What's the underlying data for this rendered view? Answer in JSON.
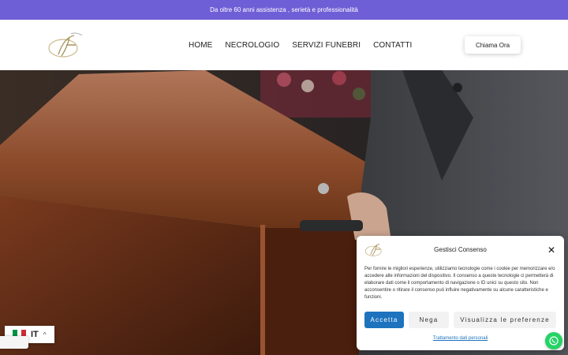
{
  "topbar": {
    "text": "Da oltre 60 anni assistenza , serietà e professionalità"
  },
  "header": {
    "nav": [
      "HOME",
      "NECROLOGIO",
      "SERVIZI FUNEBRI",
      "CONTATTI"
    ],
    "call_label": "Chiama Ora"
  },
  "language": {
    "code": "IT"
  },
  "consent": {
    "title": "Gestisci Consenso",
    "text": "Per fornire le migliori esperienze, utilizziamo tecnologie come i cookie per memorizzare e/o accedere alle informazioni del dispositivo. Il consenso a queste tecnologie ci permetterà di elaborare dati come il comportamento di navigazione o ID unici su questo sito. Non acconsentire o ritirare il consenso può influire negativamente su alcune caratteristiche e funzioni.",
    "accept_label": "Accetta",
    "deny_label": "Nega",
    "prefs_label": "Visualizza le preferenze",
    "privacy_link": "Trattamento dati personali"
  },
  "colors": {
    "topbar": "#6f5fd6",
    "accept": "#1e73be",
    "whatsapp": "#25d366"
  },
  "icons": [
    "logo-monogram",
    "italy-flag-icon",
    "chevron-up-icon",
    "close-icon",
    "whatsapp-icon"
  ]
}
